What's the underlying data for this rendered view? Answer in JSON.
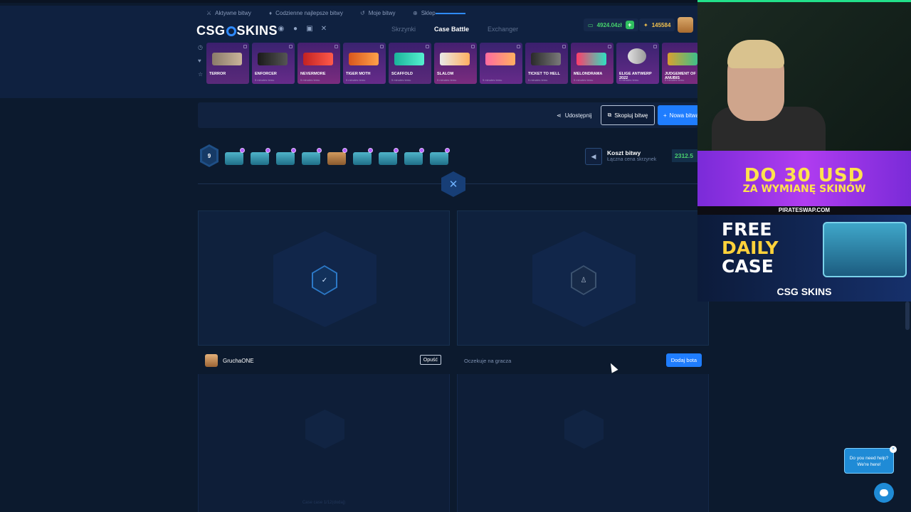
{
  "header": {
    "logo": {
      "left": "CSG",
      "right": "SKINS"
    },
    "socials": [
      "discord-icon",
      "facebook-icon",
      "instagram-icon",
      "x-icon"
    ],
    "nav": [
      {
        "label": "Skrzynki",
        "active": false
      },
      {
        "label": "Case Battle",
        "active": true
      },
      {
        "label": "Exchanger",
        "active": false
      }
    ],
    "balance": "4924.04zł",
    "points": "145584"
  },
  "drops": [
    {
      "name": "TERROR",
      "sub": ""
    },
    {
      "name": "ENFORCER",
      "sub": "5 minutes temu"
    },
    {
      "name": "NEVERMORE",
      "sub": "5 minutes temu"
    },
    {
      "name": "TIGER MOTH",
      "sub": "5 minutes temu"
    },
    {
      "name": "SCAFFOLD",
      "sub": "5 minutes temu"
    },
    {
      "name": "SLALOM",
      "sub": "5 minutes temu"
    },
    {
      "name": "",
      "sub": "5 minutes temu"
    },
    {
      "name": "TICKET TO HELL",
      "sub": "5 minutes temu"
    },
    {
      "name": "MELONDRAMA",
      "sub": "5 minutes temu"
    },
    {
      "name": "ELIGE ANTWERP 2022",
      "sub": "5 minutes temu"
    },
    {
      "name": "JUDGEMENT OF ANUBIS",
      "sub": "5 minutes temu"
    }
  ],
  "filters": {
    "active": "Aktywne bitwy",
    "daily": "Codzienne najlepsze bitwy",
    "mine": "Moje bitwy",
    "shop": "Sklep",
    "share": "Udostępnij",
    "copy": "Skopiuj bitwę",
    "new": "Nowa bitwa"
  },
  "battle": {
    "rounds": "9",
    "cost_title": "Koszt bitwy",
    "cost_sub": "Łączna cena skrzynek",
    "cost_value": "2312.5"
  },
  "players": {
    "left_name": "GruchaONE",
    "leave": "Opuść",
    "waiting": "Oczekuje na gracza",
    "add_bot": "Dodaj bota",
    "footer": "Case case 1/12(dodaj)"
  },
  "ads": {
    "ad1_big": "DO 30 USD",
    "ad1_small": "ZA WYMIANĘ SKINÓW",
    "strip": "PIRATESWAP.COM",
    "l1": "FREE",
    "l2": "DAILY",
    "l3": "CASE",
    "logo": "CSG SKINS"
  },
  "help": {
    "line1": "Do you need help?",
    "line2": "We're here!"
  }
}
